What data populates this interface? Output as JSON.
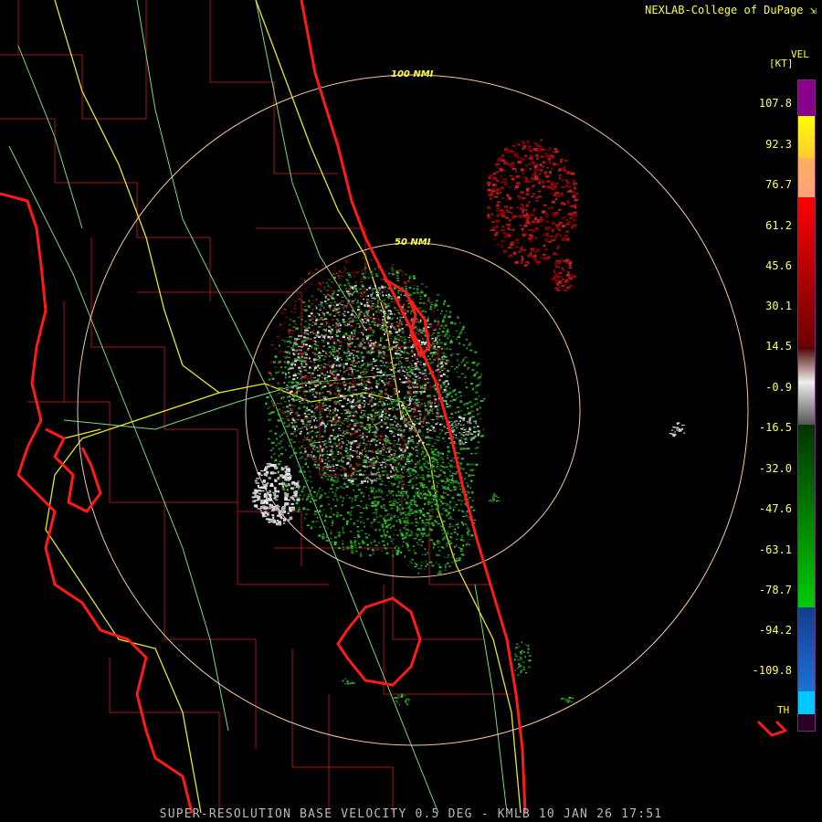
{
  "header": {
    "credit": "NEXLAB-College of DuPage"
  },
  "radar": {
    "rings": [
      {
        "label": "100 NMI"
      },
      {
        "label": "50 NMI"
      }
    ]
  },
  "legend": {
    "product_short": "VEL",
    "unit": "[KT]",
    "ticks": [
      "107.8",
      "92.3",
      "76.7",
      "61.2",
      "45.6",
      "30.1",
      "14.5",
      "-0.9",
      "-16.5",
      "-32.0",
      "-47.6",
      "-63.1",
      "-78.7",
      "-94.2",
      "-109.8"
    ],
    "bottom_label": "TH",
    "colors": {
      "purple": "#8b008b",
      "yellow": "#ffff00",
      "salmon": "#ffa07a",
      "red": "#ff0000",
      "darkred": "#6b0000",
      "gray": "#a0a0a0",
      "green": "#00cc00",
      "blue": "#1e70d8",
      "cyan": "#00c8ff",
      "rf": "#2a0028"
    }
  },
  "footer": {
    "caption": "SUPER-RESOLUTION BASE VELOCITY 0.5 DEG - KMLB 10 JAN 26 17:51"
  }
}
